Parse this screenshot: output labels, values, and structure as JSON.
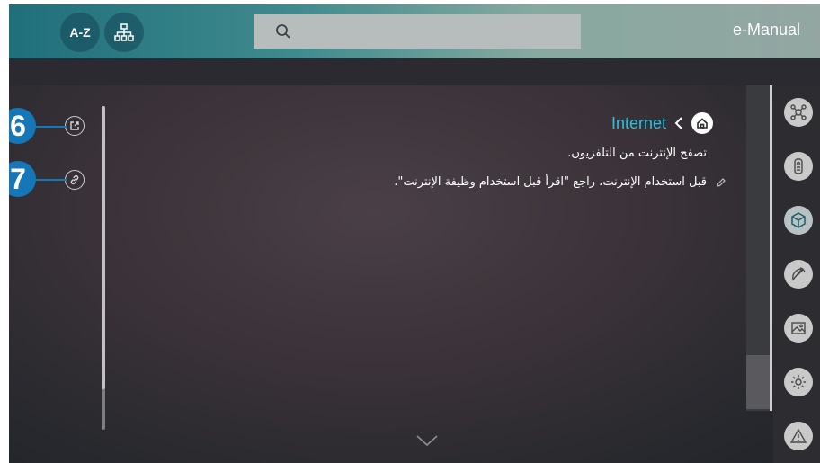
{
  "header": {
    "az_label": "A-Z",
    "title": "e-Manual",
    "search_placeholder": ""
  },
  "breadcrumb": {
    "page_title": "Internet"
  },
  "content": {
    "description": "تصفح الإنترنت من التلفزيون.",
    "note": "قبل استخدام الإنترنت، راجع \"اقرأ قبل استخدام وظيفة الإنترنت\"."
  },
  "callouts": {
    "six": "6",
    "seven": "7"
  },
  "colors": {
    "accent": "#2ec1e0",
    "callout": "#1577b8"
  },
  "sidebar": {
    "icons": [
      "network-icon",
      "remote-icon",
      "apps-icon",
      "satellite-icon",
      "picture-icon",
      "settings-icon",
      "warning-icon"
    ],
    "active": "apps-icon"
  }
}
